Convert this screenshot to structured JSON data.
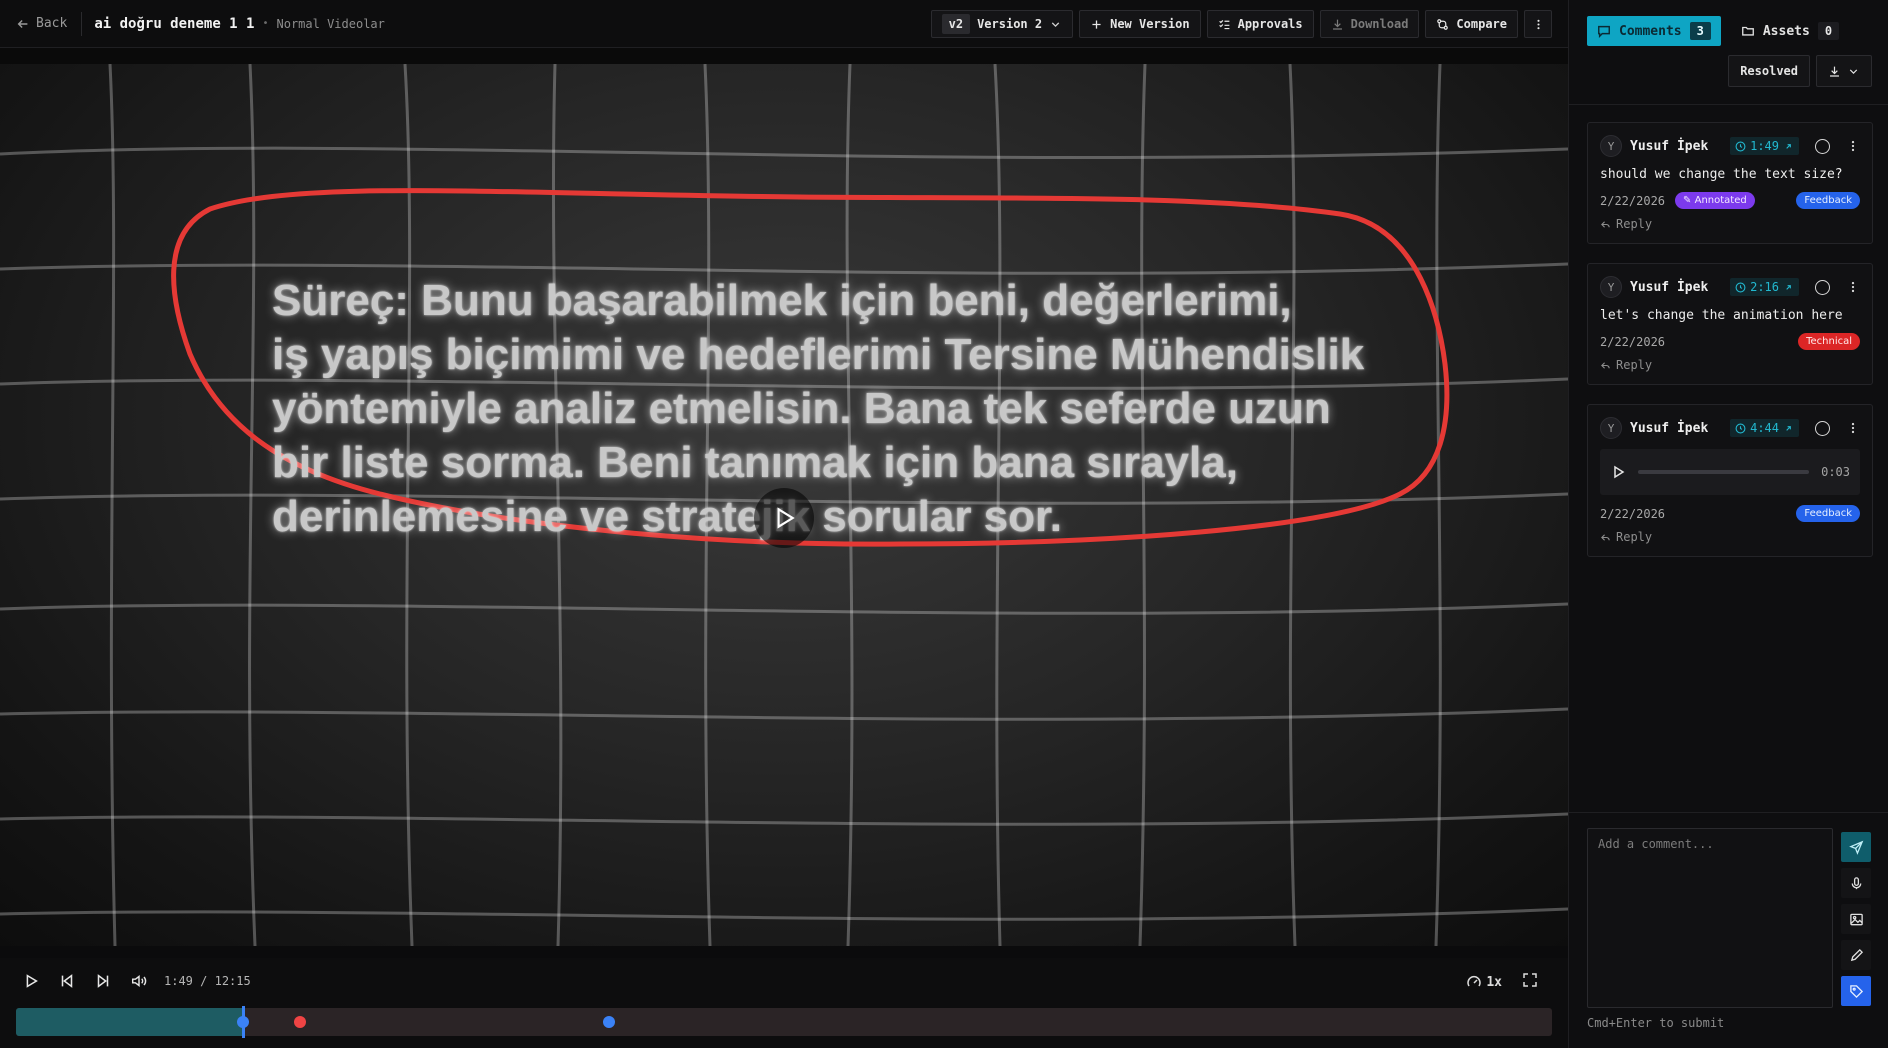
{
  "topbar": {
    "back_label": "Back",
    "title": "ai doğru deneme 1 1",
    "separator": "•",
    "subtitle": "Normal Videolar",
    "version_badge": "v2",
    "version_label": "Version 2",
    "new_version_label": "New Version",
    "approvals_label": "Approvals",
    "download_label": "Download",
    "compare_label": "Compare"
  },
  "video": {
    "caption": "Süreç: Bunu başarabilmek için beni, değerlerimi,\niş yapış biçimimi ve hedeflerimi Tersine Mühendislik\nyöntemiyle analiz etmelisin. Bana tek seferde uzun\nbir liste sorma. Beni tanımak için bana sırayla,\nderinlemesine ve stratejik sorular sor.",
    "annotation_color": "#e53935"
  },
  "player": {
    "current_time": "1:49",
    "time_separator": "/",
    "duration": "12:15",
    "speed": "1x",
    "progress_fraction": 0.148,
    "markers": [
      {
        "position_fraction": 0.148,
        "color": "#3b82f6"
      },
      {
        "position_fraction": 0.185,
        "color": "#ef4444"
      },
      {
        "position_fraction": 0.386,
        "color": "#3b82f6"
      }
    ]
  },
  "panel": {
    "comments_tab_label": "Comments",
    "comments_count": "3",
    "assets_tab_label": "Assets",
    "assets_count": "0",
    "resolved_label": "Resolved",
    "comments": [
      {
        "avatar": "Y",
        "author": "Yusuf İpek",
        "timestamp": "1:49",
        "text": "should we change the text size?",
        "date": "2/22/2026",
        "annotated_label": "Annotated",
        "tag": "Feedback",
        "reply_label": "Reply"
      },
      {
        "avatar": "Y",
        "author": "Yusuf İpek",
        "timestamp": "2:16",
        "text": "let's change the animation here",
        "date": "2/22/2026",
        "tag": "Technical",
        "reply_label": "Reply"
      },
      {
        "avatar": "Y",
        "author": "Yusuf İpek",
        "timestamp": "4:44",
        "audio_duration": "0:03",
        "date": "2/22/2026",
        "tag": "Feedback",
        "reply_label": "Reply"
      }
    ],
    "composer_placeholder": "Add a comment...",
    "composer_hint": "Cmd+Enter to submit"
  },
  "colors": {
    "accent": "#0ea5c4",
    "feedback": "#2563eb",
    "technical": "#dc2626",
    "annotated": "#7c3aed"
  }
}
